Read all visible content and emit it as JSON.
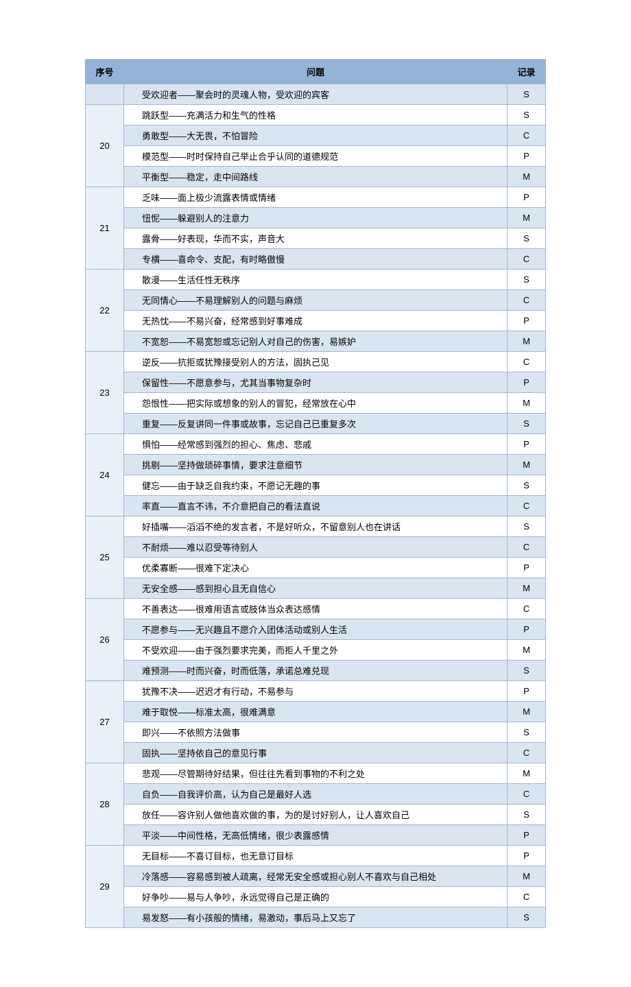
{
  "chart_data": {
    "type": "table",
    "title": "",
    "columns": [
      "序号",
      "问题",
      "记录"
    ],
    "rows": [
      {
        "seq": "",
        "q": "受欢迎者——聚会时的灵魂人物，受欢迎的宾客",
        "rec": "S"
      },
      {
        "seq": "20",
        "q": "跳跃型——充满活力和生气的性格",
        "rec": "S"
      },
      {
        "seq": "20",
        "q": "勇敢型——大无畏，不怕冒险",
        "rec": "C"
      },
      {
        "seq": "20",
        "q": "模范型——时时保持自己举止合乎认同的道德规范",
        "rec": "P"
      },
      {
        "seq": "20",
        "q": "平衡型——稳定，走中间路线",
        "rec": "M"
      },
      {
        "seq": "21",
        "q": "乏味——面上极少流露表情或情绪",
        "rec": "P"
      },
      {
        "seq": "21",
        "q": "忸怩——躲避别人的注意力",
        "rec": "M"
      },
      {
        "seq": "21",
        "q": "露骨——好表现，华而不实，声音大",
        "rec": "S"
      },
      {
        "seq": "21",
        "q": "专横——喜命令、支配，有时略傲慢",
        "rec": "C"
      },
      {
        "seq": "22",
        "q": "散漫——生活任性无秩序",
        "rec": "S"
      },
      {
        "seq": "22",
        "q": "无同情心——不易理解别人的问题与麻烦",
        "rec": "C"
      },
      {
        "seq": "22",
        "q": "无热忱——不易兴奋，经常感到好事难成",
        "rec": "P"
      },
      {
        "seq": "22",
        "q": "不宽恕——不易宽恕或忘记别人对自己的伤害，易嫉妒",
        "rec": "M"
      },
      {
        "seq": "23",
        "q": "逆反——抗拒或犹豫接受别人的方法，固执己见",
        "rec": "C"
      },
      {
        "seq": "23",
        "q": "保留性——不愿意参与，尤其当事物复杂时",
        "rec": "P"
      },
      {
        "seq": "23",
        "q": "怨恨性——把实际或想象的别人的冒犯，经常放在心中",
        "rec": "M"
      },
      {
        "seq": "23",
        "q": "重复——反复讲同一件事或故事，忘记自己已重复多次",
        "rec": "S"
      },
      {
        "seq": "24",
        "q": "惧怕——经常感到强烈的担心、焦虑、悲戚",
        "rec": "P"
      },
      {
        "seq": "24",
        "q": "挑剔——坚持做琐碎事情，要求注意细节",
        "rec": "M"
      },
      {
        "seq": "24",
        "q": "健忘——由于缺乏自我约束，不愿记无趣的事",
        "rec": "S"
      },
      {
        "seq": "24",
        "q": "率直——直言不讳，不介意把自己的看法直说",
        "rec": "C"
      },
      {
        "seq": "25",
        "q": "好插嘴——滔滔不绝的发言者，不是好听众，不留意别人也在讲话",
        "rec": "S"
      },
      {
        "seq": "25",
        "q": "不耐烦——难以忍受等待别人",
        "rec": "C"
      },
      {
        "seq": "25",
        "q": "优柔寡断——很难下定决心",
        "rec": "P"
      },
      {
        "seq": "25",
        "q": "无安全感——感到担心且无自信心",
        "rec": "M"
      },
      {
        "seq": "26",
        "q": "不善表达——很难用语言或肢体当众表达感情",
        "rec": "C"
      },
      {
        "seq": "26",
        "q": "不愿参与——无兴趣且不愿介入团体活动或别人生活",
        "rec": "P"
      },
      {
        "seq": "26",
        "q": "不受欢迎——由于强烈要求完美，而拒人千里之外",
        "rec": "M"
      },
      {
        "seq": "26",
        "q": "难预测——时而兴奋，时而低落，承诺总难兑现",
        "rec": "S"
      },
      {
        "seq": "27",
        "q": "犹豫不决——迟迟才有行动，不易参与",
        "rec": "P"
      },
      {
        "seq": "27",
        "q": "难于取悦——标准太高，很难满意",
        "rec": "M"
      },
      {
        "seq": "27",
        "q": "即兴——不依照方法做事",
        "rec": "S"
      },
      {
        "seq": "27",
        "q": "固执——坚持依自己的意见行事",
        "rec": "C"
      },
      {
        "seq": "28",
        "q": "悲观——尽管期待好结果，但往往先看到事物的不利之处",
        "rec": "M"
      },
      {
        "seq": "28",
        "q": "自负——自我评价高，认为自己是最好人选",
        "rec": "C"
      },
      {
        "seq": "28",
        "q": "放任——容许别人做他喜欢做的事，为的是讨好别人，让人喜欢自己",
        "rec": "S"
      },
      {
        "seq": "28",
        "q": "平淡——中间性格，无高低情绪，很少表露感情",
        "rec": "P"
      },
      {
        "seq": "29",
        "q": "无目标——不喜订目标，也无意订目标",
        "rec": "P"
      },
      {
        "seq": "29",
        "q": "冷落感——容易感到被人疏离，经常无安全感或担心别人不喜欢与自己相处",
        "rec": "M"
      },
      {
        "seq": "29",
        "q": "好争吵——易与人争吵，永远觉得自己是正确的",
        "rec": "C"
      },
      {
        "seq": "29",
        "q": "易发怒——有小孩般的情绪，易激动，事后马上又忘了",
        "rec": "S"
      }
    ]
  },
  "headers": {
    "seq": "序号",
    "q": "问题",
    "rec": "记录"
  }
}
